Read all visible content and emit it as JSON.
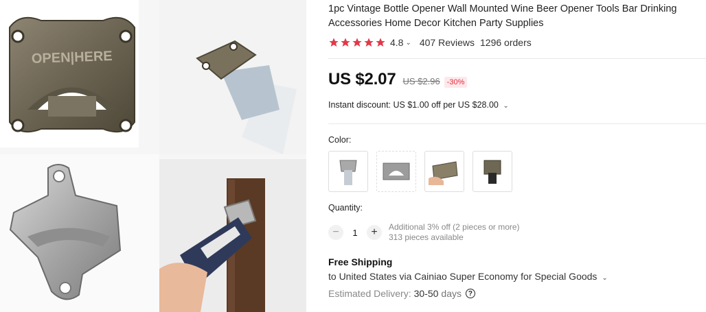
{
  "product": {
    "title": "1pc Vintage Bottle Opener Wall Mounted Wine Beer Opener Tools Bar Drinking Accessories Home Decor Kitchen Party Supplies",
    "rating": "4.8",
    "reviews": "407 Reviews",
    "orders": "1296 orders",
    "stars": 5
  },
  "price": {
    "current": "US $2.07",
    "original": "US $2.96",
    "discount": "-30%"
  },
  "instant_discount": "Instant discount: US $1.00 off per US $28.00",
  "color": {
    "label": "Color:"
  },
  "quantity": {
    "label": "Quantity:",
    "value": "1",
    "note_line1": "Additional 3% off (2 pieces or more)",
    "note_line2": "313 pieces available"
  },
  "shipping": {
    "title": "Free Shipping",
    "to": "to United States via Cainiao Super Economy for Special Goods",
    "delivery_label": "Estimated Delivery:",
    "delivery_value": "30-50",
    "delivery_unit": "days"
  },
  "gallery": {
    "opener_text": "OPEN|HERE"
  },
  "colors": {
    "star": "#e2394a",
    "discount": "#e22e3c"
  }
}
